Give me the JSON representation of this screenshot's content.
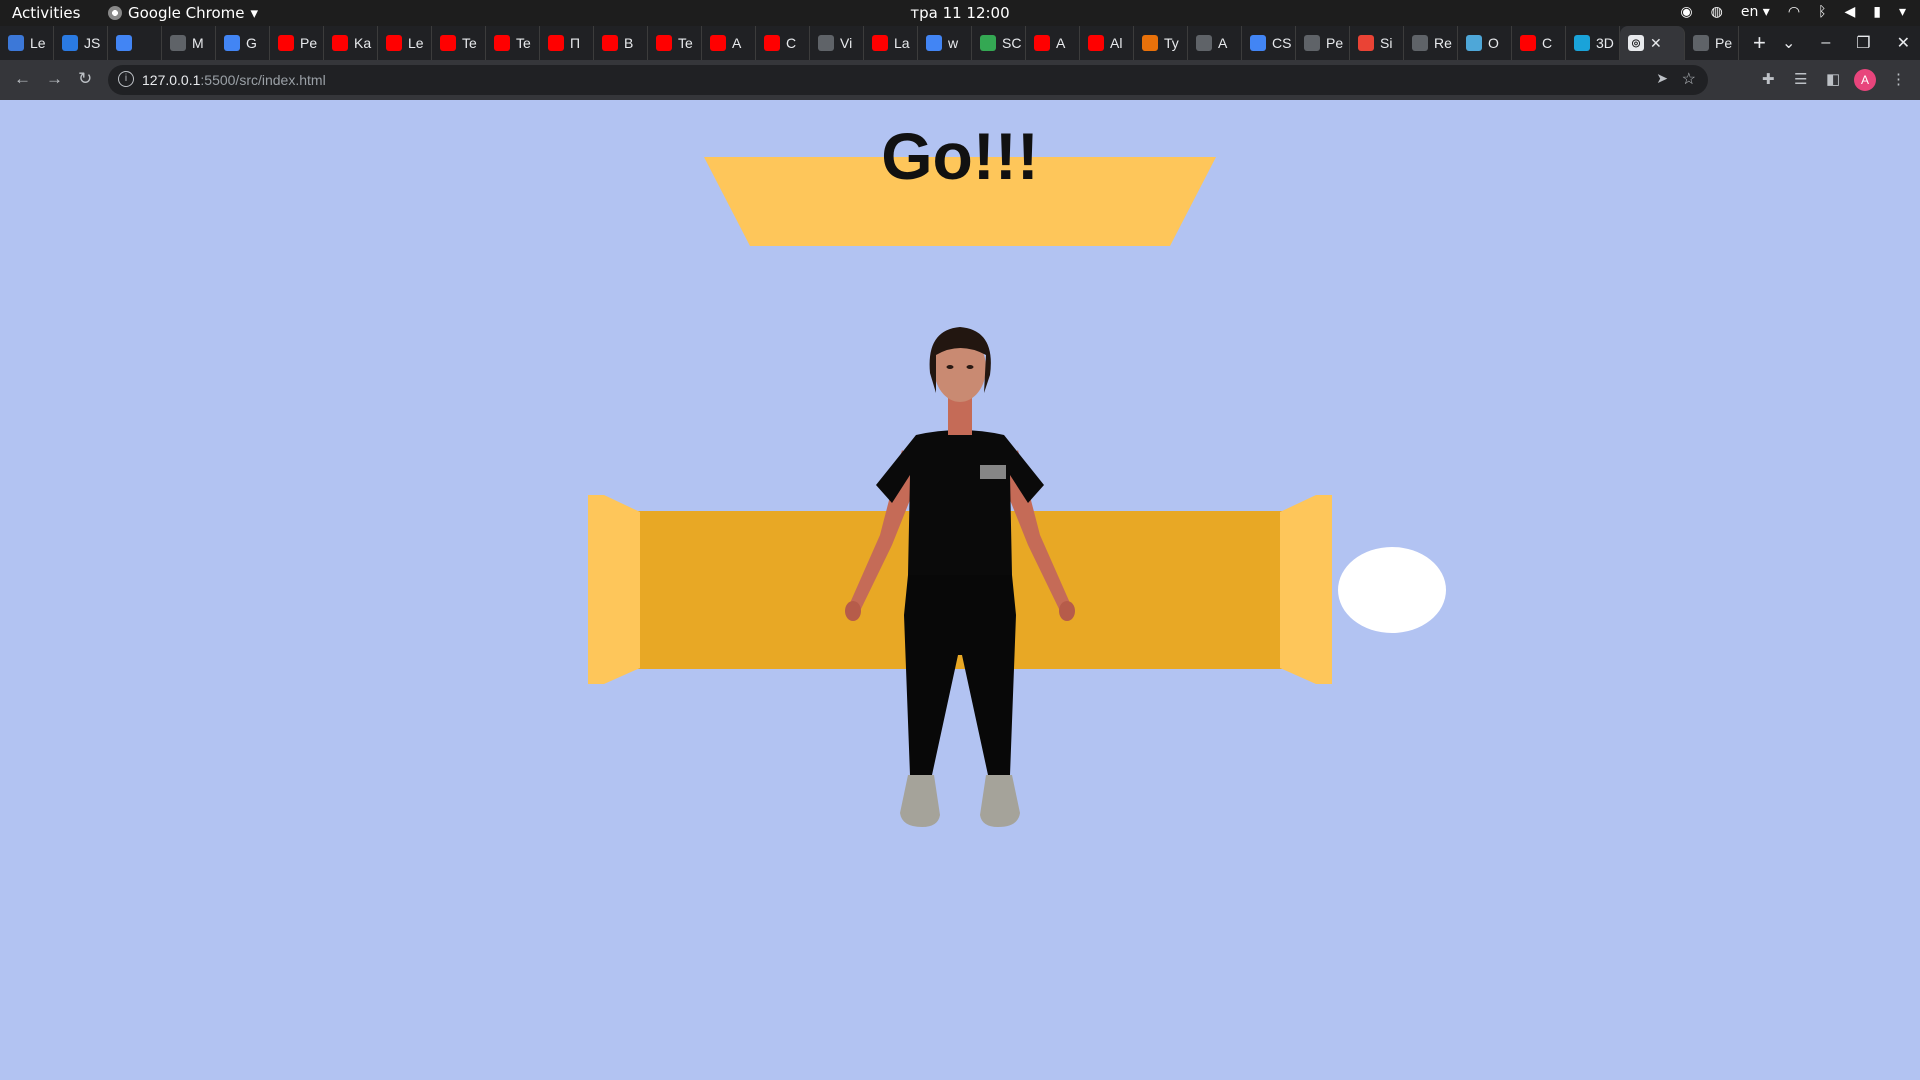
{
  "system_bar": {
    "activities": "Activities",
    "app_name": "Google Chrome",
    "clock": "тра 11  12:00",
    "lang": "en"
  },
  "tabs": [
    {
      "title": "Le",
      "color": "#3c78d8",
      "icon": "stack-icon"
    },
    {
      "title": "JS",
      "color": "#2a7ae2",
      "icon": "docs-icon"
    },
    {
      "title": "",
      "color": "#4285f4",
      "icon": "google-icon"
    },
    {
      "title": "M",
      "color": "#5f6368",
      "icon": "globe-icon"
    },
    {
      "title": "G",
      "color": "#4285f4",
      "icon": "translate-icon"
    },
    {
      "title": "Pe",
      "color": "#ff0000",
      "icon": "youtube-icon"
    },
    {
      "title": "Ka",
      "color": "#ff0000",
      "icon": "youtube-icon"
    },
    {
      "title": "Le",
      "color": "#ff0000",
      "icon": "youtube-icon"
    },
    {
      "title": "Te",
      "color": "#ff0000",
      "icon": "youtube-icon"
    },
    {
      "title": "Te",
      "color": "#ff0000",
      "icon": "youtube-icon"
    },
    {
      "title": "П",
      "color": "#ff0000",
      "icon": "youtube-icon"
    },
    {
      "title": "B",
      "color": "#ff0000",
      "icon": "youtube-icon"
    },
    {
      "title": "Te",
      "color": "#ff0000",
      "icon": "youtube-icon"
    },
    {
      "title": "A",
      "color": "#ff0000",
      "icon": "youtube-icon"
    },
    {
      "title": "C",
      "color": "#ff0000",
      "icon": "youtube-icon"
    },
    {
      "title": "Vi",
      "color": "#5f6368",
      "icon": "globe-icon"
    },
    {
      "title": "La",
      "color": "#ff0000",
      "icon": "youtube-icon"
    },
    {
      "title": "w",
      "color": "#4285f4",
      "icon": "google-icon"
    },
    {
      "title": "SC",
      "color": "#34a853",
      "icon": "w-icon"
    },
    {
      "title": "A",
      "color": "#ff0000",
      "icon": "youtube-icon"
    },
    {
      "title": "Al",
      "color": "#ff0000",
      "icon": "youtube-icon"
    },
    {
      "title": "Ty",
      "color": "#e8710a",
      "icon": "t-icon"
    },
    {
      "title": "A",
      "color": "#5f6368",
      "icon": "m-icon"
    },
    {
      "title": "CS",
      "color": "#4285f4",
      "icon": "w3-icon"
    },
    {
      "title": "Pe",
      "color": "#5f6368",
      "icon": "p-icon"
    },
    {
      "title": "Si",
      "color": "#ea4335",
      "icon": "gmail-icon"
    },
    {
      "title": "Re",
      "color": "#5f6368",
      "icon": "keyboard-icon"
    },
    {
      "title": "O",
      "color": "#4ea7d8",
      "icon": "o-icon"
    },
    {
      "title": "C",
      "color": "#ff0000",
      "icon": "youtube-icon"
    },
    {
      "title": "3D",
      "color": "#1aa3d9",
      "icon": "threejs-icon"
    }
  ],
  "tabs_after": [
    {
      "title": "Pe",
      "color": "#5f6368",
      "icon": "github-icon"
    }
  ],
  "active_tab": {
    "title": "",
    "close": "✕"
  },
  "address_bar": {
    "url_host": "127.0.0.1",
    "url_path": ":5500/src/index.html"
  },
  "profile_initial": "A",
  "game": {
    "status_text": "Go!!!",
    "colors": {
      "sky": "#b2c3f2",
      "banner": "#fec65a",
      "track": "#e8a825",
      "track_caps": "#fec65a",
      "ball": "#ffffff"
    }
  }
}
